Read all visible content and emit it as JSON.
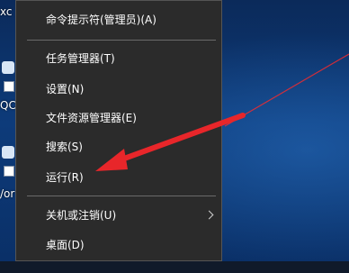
{
  "desktop": {
    "labels": [
      "xc",
      "QC",
      "/or"
    ]
  },
  "context_menu": {
    "items": [
      {
        "label": "命令提示符(管理员)(A)"
      },
      {
        "label": "任务管理器(T)"
      },
      {
        "label": "设置(N)"
      },
      {
        "label": "文件资源管理器(E)"
      },
      {
        "label": "搜索(S)"
      },
      {
        "label": "运行(R)"
      },
      {
        "label": "关机或注销(U)"
      },
      {
        "label": "桌面(D)"
      }
    ]
  },
  "colors": {
    "menu_bg": "#2b2b2b",
    "menu_text": "#ffffff",
    "arrow": "#e8262a"
  }
}
